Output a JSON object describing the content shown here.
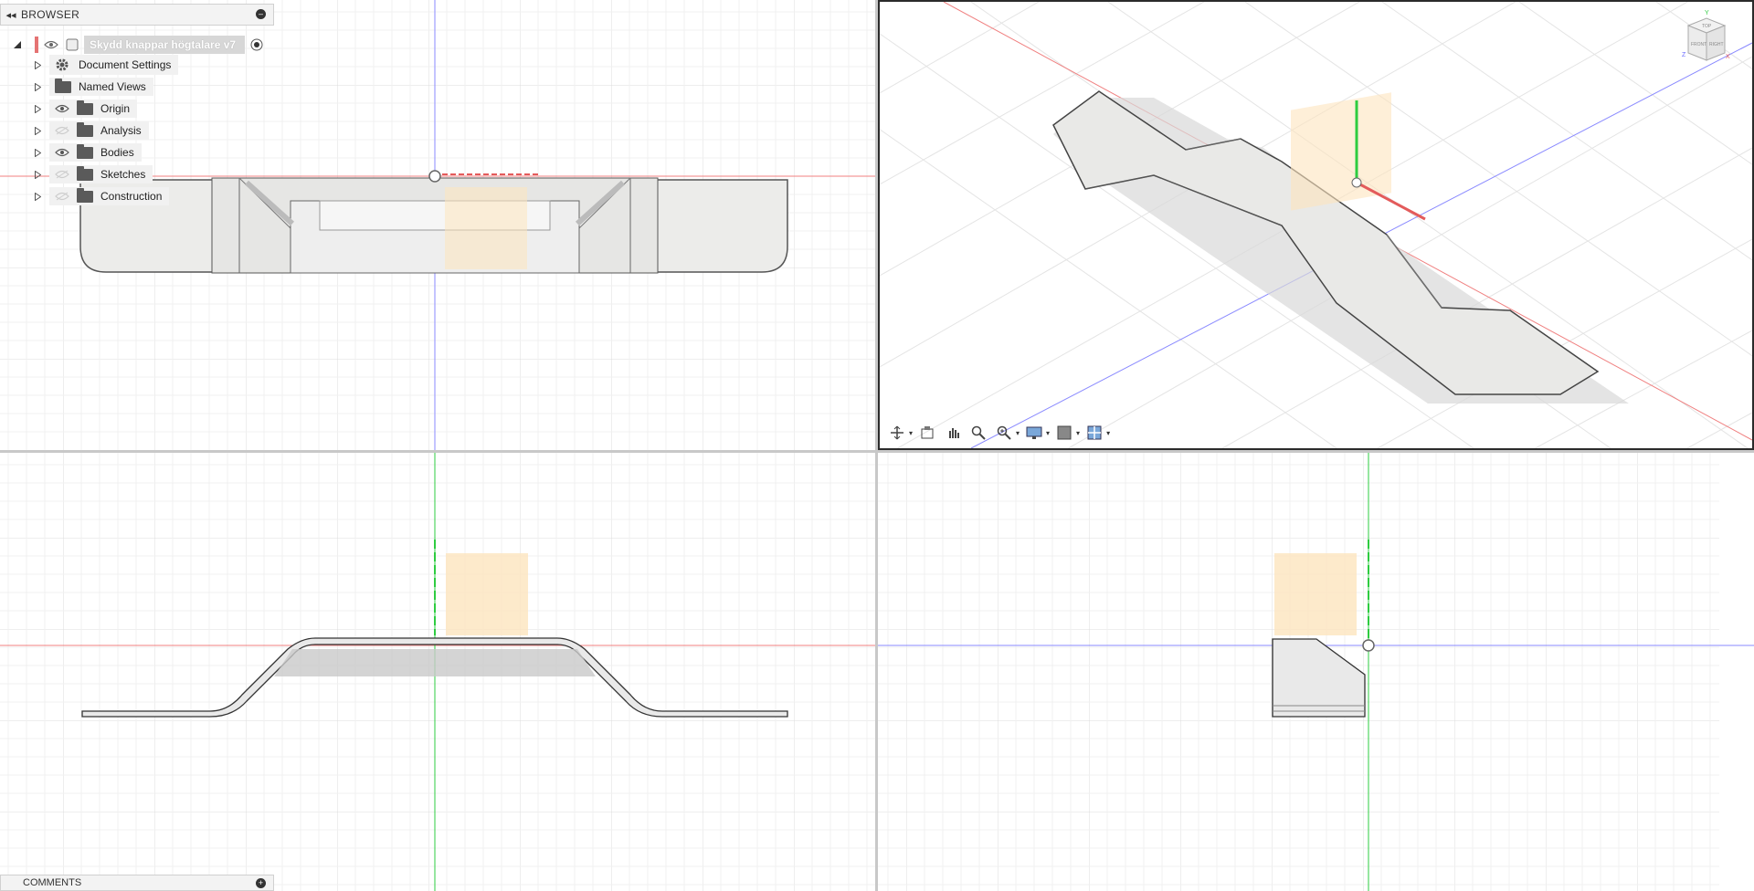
{
  "browser": {
    "title": "BROWSER",
    "root": {
      "label": "Skydd knappar högtalare v7"
    },
    "items": [
      {
        "label": "Document Settings",
        "icon": "gear-icon",
        "visible": null
      },
      {
        "label": "Named Views",
        "icon": "folder-icon",
        "visible": null
      },
      {
        "label": "Origin",
        "icon": "folder-icon",
        "visible": true
      },
      {
        "label": "Analysis",
        "icon": "folder-icon",
        "visible": false
      },
      {
        "label": "Bodies",
        "icon": "folder-icon",
        "visible": true
      },
      {
        "label": "Sketches",
        "icon": "folder-icon",
        "visible": false
      },
      {
        "label": "Construction",
        "icon": "folder-icon",
        "visible": false
      }
    ]
  },
  "comments": {
    "title": "COMMENTS"
  },
  "viewcube": {
    "top": "TOP",
    "front": "FRONT",
    "right": "RIGHT",
    "axis_x": "X",
    "axis_y": "Y",
    "axis_z": "Z"
  },
  "colors": {
    "x_axis": "#e35b5b",
    "y_axis": "#2ecc40",
    "z_axis": "#6b6bff",
    "origin_plane": "#fde5be",
    "body": "#ebebeb"
  },
  "navbar": [
    "orbit-icon",
    "look-at-icon",
    "pan-icon",
    "zoom-icon",
    "fit-icon",
    "display-settings-icon",
    "grid-settings-icon",
    "viewports-icon"
  ]
}
